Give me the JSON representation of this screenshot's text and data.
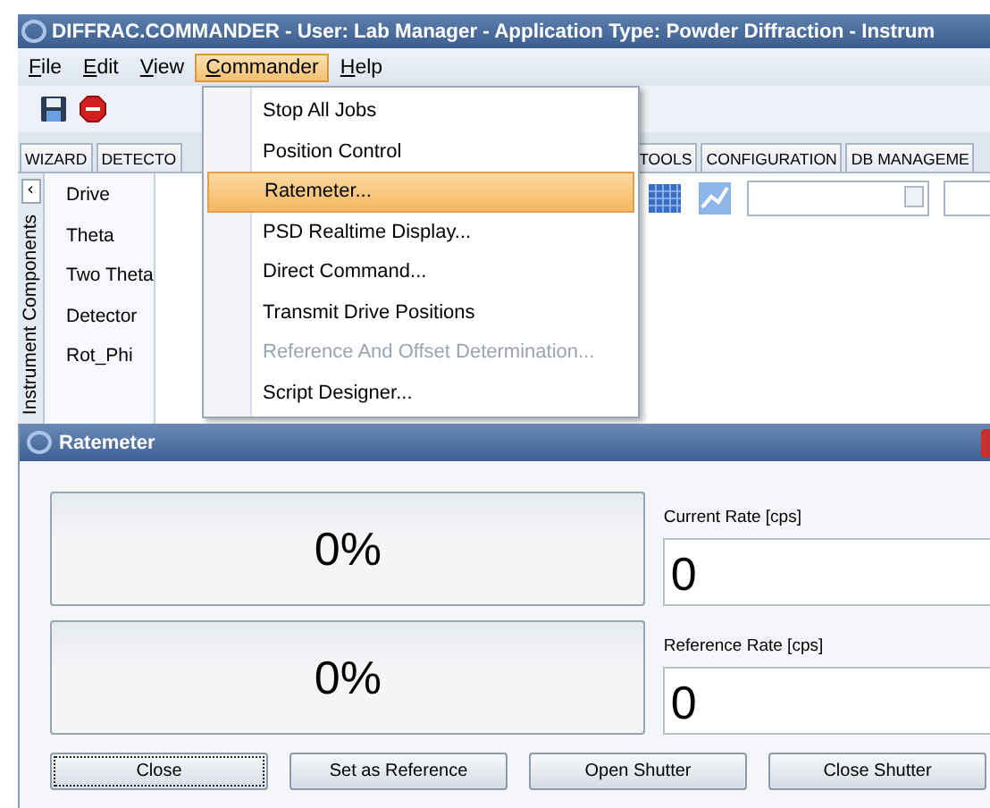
{
  "window": {
    "title": "DIFFRAC.COMMANDER - User: Lab Manager - Application Type: Powder Diffraction - Instrum"
  },
  "menu_bar": [
    {
      "label": "File",
      "selected": false
    },
    {
      "label": "Edit",
      "selected": false
    },
    {
      "label": "View",
      "selected": false
    },
    {
      "label": "Commander",
      "selected": true
    },
    {
      "label": "Help",
      "selected": false
    }
  ],
  "tabs": [
    {
      "label": "WIZARD",
      "selected": false
    },
    {
      "label": "DETECTO",
      "selected": false
    },
    {
      "label": "TOOLS",
      "selected": false
    },
    {
      "label": "CONFIGURATION",
      "selected": false
    },
    {
      "label": "DB MANAGEME",
      "selected": false
    }
  ],
  "side_panel": {
    "title": "Instrument Components",
    "collapse_glyph": "‹",
    "items": [
      "Drive",
      "Theta",
      "Two Theta",
      "Detector",
      "Rot_Phi"
    ]
  },
  "commander_menu": [
    {
      "label": "Stop All Jobs",
      "selected": false,
      "disabled": false
    },
    {
      "label": "Position Control",
      "selected": false,
      "disabled": false
    },
    {
      "label": "Ratemeter...",
      "selected": true,
      "disabled": false
    },
    {
      "label": "PSD Realtime Display...",
      "selected": false,
      "disabled": false
    },
    {
      "label": "Direct Command...",
      "selected": false,
      "disabled": false
    },
    {
      "label": "Transmit Drive Positions",
      "selected": false,
      "disabled": false
    },
    {
      "label": "Reference And Offset Determination...",
      "selected": false,
      "disabled": true
    },
    {
      "label": "Script Designer...",
      "selected": false,
      "disabled": false
    }
  ],
  "dialog": {
    "title": "Ratemeter",
    "meters": [
      {
        "reading": "0%",
        "level": 0,
        "field_label": "Current Rate [cps]",
        "value": "0"
      },
      {
        "reading": "0%",
        "level": 0,
        "field_label": "Reference Rate [cps]",
        "value": "0"
      }
    ],
    "buttons": [
      {
        "label": "Close",
        "focused": true
      },
      {
        "label": "Set as Reference",
        "focused": false
      },
      {
        "label": "Open Shutter",
        "focused": false
      },
      {
        "label": "Close Shutter",
        "focused": false
      }
    ]
  }
}
